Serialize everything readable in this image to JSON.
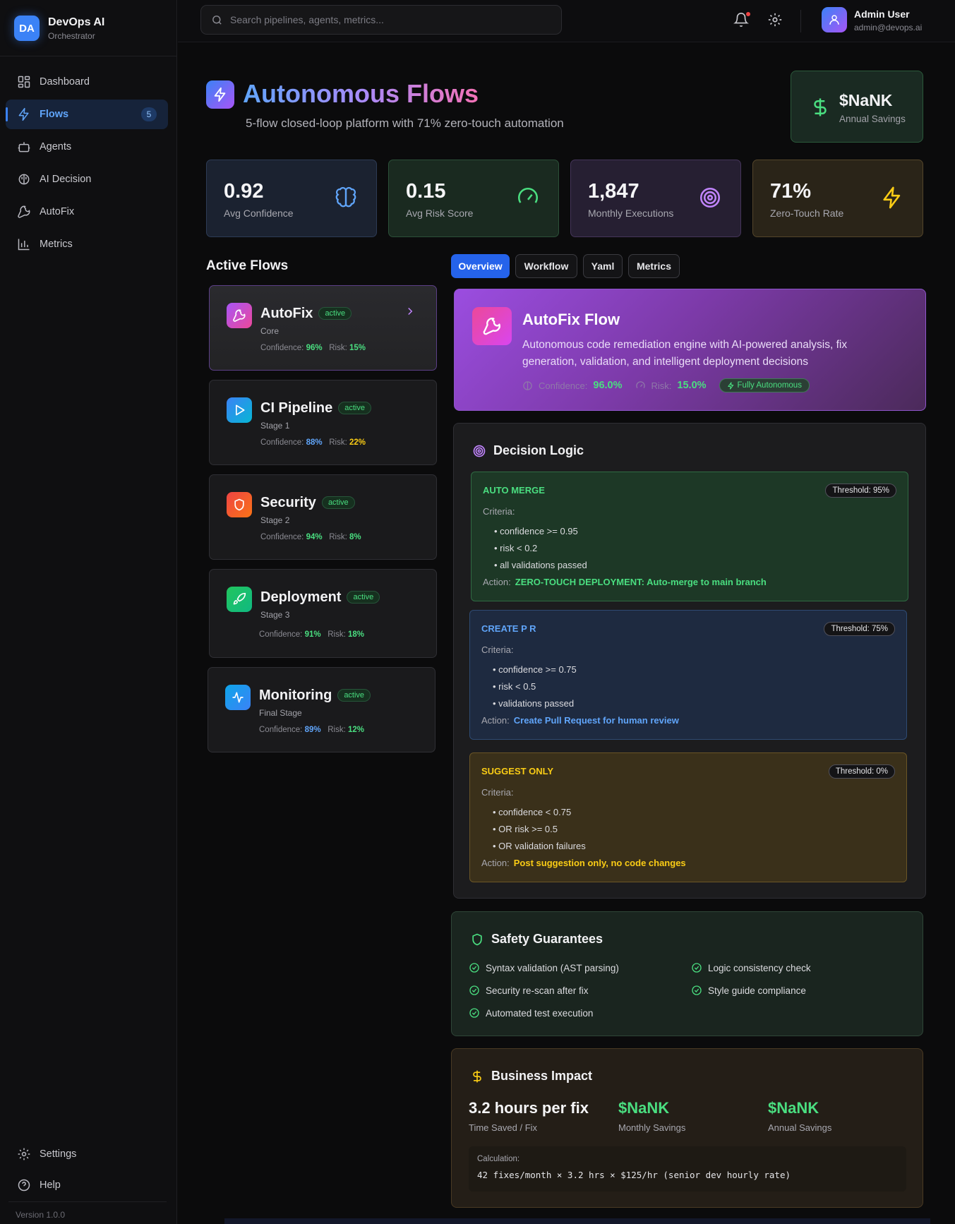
{
  "brand": {
    "logo": "DA",
    "name": "DevOps AI",
    "subtitle": "Orchestrator"
  },
  "sidebar": {
    "items": [
      {
        "label": "Dashboard",
        "icon": "dashboard-icon"
      },
      {
        "label": "Flows",
        "icon": "zap-icon",
        "badge": "5",
        "active": true
      },
      {
        "label": "Agents",
        "icon": "bot-icon"
      },
      {
        "label": "AI Decision",
        "icon": "brain-icon"
      },
      {
        "label": "AutoFix",
        "icon": "wrench-icon"
      },
      {
        "label": "Metrics",
        "icon": "bar-chart-icon"
      }
    ],
    "bottom": [
      {
        "label": "Settings",
        "icon": "gear-icon"
      },
      {
        "label": "Help",
        "icon": "help-circle-icon"
      }
    ],
    "version": "Version 1.0.0"
  },
  "topbar": {
    "search_placeholder": "Search pipelines, agents, metrics...",
    "user_name": "Admin User",
    "user_email": "admin@devops.ai"
  },
  "header": {
    "title": "Autonomous Flows",
    "subtitle": "5-flow closed-loop platform with 71% zero-touch automation",
    "savings_value": "$NaNK",
    "savings_label": "Annual Savings"
  },
  "stats": [
    {
      "value": "0.92",
      "label": "Avg Confidence",
      "icon": "brain-icon",
      "color": "#60a5fa"
    },
    {
      "value": "0.15",
      "label": "Avg Risk Score",
      "icon": "gauge-icon",
      "color": "#4ade80"
    },
    {
      "value": "1,847",
      "label": "Monthly Executions",
      "icon": "target-icon",
      "color": "#c084fc"
    },
    {
      "value": "71%",
      "label": "Zero-Touch Rate",
      "icon": "zap-icon",
      "color": "#facc15"
    }
  ],
  "active_flows": {
    "title": "Active Flows",
    "confidence_label": "Confidence:",
    "risk_label": "Risk:",
    "items": [
      {
        "name": "AutoFix",
        "status": "active",
        "stage": "Core",
        "confidence": "96%",
        "risk": "15%",
        "icon": "wrench-icon"
      },
      {
        "name": "CI Pipeline",
        "status": "active",
        "stage": "Stage 1",
        "confidence": "88%",
        "risk": "22%",
        "icon": "play-icon"
      },
      {
        "name": "Security",
        "status": "active",
        "stage": "Stage 2",
        "confidence": "94%",
        "risk": "8%",
        "icon": "shield-icon"
      },
      {
        "name": "Deployment",
        "status": "active",
        "stage": "Stage 3",
        "confidence": "91%",
        "risk": "18%",
        "icon": "rocket-icon"
      },
      {
        "name": "Monitoring",
        "status": "active",
        "stage": "Final Stage",
        "confidence": "89%",
        "risk": "12%",
        "icon": "activity-icon"
      }
    ]
  },
  "tabs": [
    "Overview",
    "Workflow",
    "Yaml",
    "Metrics"
  ],
  "flow_detail": {
    "title": "AutoFix Flow",
    "description": "Autonomous code remediation engine with AI-powered analysis, fix generation, validation, and intelligent deployment decisions",
    "confidence_label": "Confidence:",
    "confidence": "96.0%",
    "risk_label": "Risk:",
    "risk": "15.0%",
    "mode_badge": "Fully Autonomous"
  },
  "decision_logic": {
    "title": "Decision Logic",
    "criteria_label": "Criteria:",
    "action_label": "Action:",
    "rules": [
      {
        "name": "AUTO MERGE",
        "threshold": "Threshold: 95%",
        "criteria": [
          "confidence >= 0.95",
          "risk < 0.2",
          "all validations passed"
        ],
        "action": "ZERO-TOUCH DEPLOYMENT: Auto-merge to main branch"
      },
      {
        "name": "CREATE P R",
        "threshold": "Threshold: 75%",
        "criteria": [
          "confidence >= 0.75",
          "risk < 0.5",
          "validations passed"
        ],
        "action": "Create Pull Request for human review"
      },
      {
        "name": "SUGGEST ONLY",
        "threshold": "Threshold: 0%",
        "criteria": [
          "confidence < 0.75",
          "OR risk >= 0.5",
          "OR validation failures"
        ],
        "action": "Post suggestion only, no code changes"
      }
    ]
  },
  "safety": {
    "title": "Safety Guarantees",
    "items": [
      "Syntax validation (AST parsing)",
      "Logic consistency check",
      "Security re-scan after fix",
      "Style guide compliance",
      "Automated test execution"
    ]
  },
  "business_impact": {
    "title": "Business Impact",
    "metrics": [
      {
        "value": "3.2 hours per fix",
        "label": "Time Saved / Fix"
      },
      {
        "value": "$NaNK",
        "label": "Monthly Savings"
      },
      {
        "value": "$NaNK",
        "label": "Annual Savings"
      }
    ],
    "calc_label": "Calculation:",
    "calc_text": "42 fixes/month × 3.2 hrs × $125/hr (senior dev hourly rate)"
  }
}
